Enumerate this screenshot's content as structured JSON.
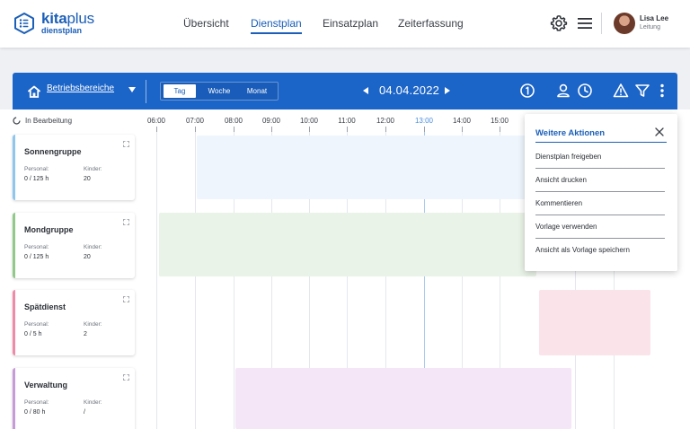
{
  "app": {
    "logo_main_bold": "kita",
    "logo_main_rest": "plus",
    "logo_sub": "dienstplan"
  },
  "nav": {
    "items": [
      {
        "label": "Übersicht",
        "active": false
      },
      {
        "label": "Dienstplan",
        "active": true
      },
      {
        "label": "Einsatzplan",
        "active": false
      },
      {
        "label": "Zeiterfassung",
        "active": false
      }
    ]
  },
  "user": {
    "name": "Lisa Lee",
    "role": "Leitung"
  },
  "toolbar": {
    "area_select": "Betriebsbereiche",
    "views": [
      {
        "label": "Tag",
        "active": true
      },
      {
        "label": "Woche",
        "active": false
      },
      {
        "label": "Monat",
        "active": false
      }
    ],
    "date": "04.04.2022",
    "icons": [
      "info-circle-icon",
      "user-outline-icon",
      "clock-icon",
      "warning-icon",
      "filter-icon",
      "more-vertical-icon"
    ]
  },
  "timeline": {
    "status": "In Bearbeitung",
    "hours": [
      "06:00",
      "07:00",
      "08:00",
      "09:00",
      "10:00",
      "11:00",
      "12:00",
      "13:00",
      "14:00",
      "15:00"
    ],
    "current_hour": "13:00"
  },
  "groups": [
    {
      "name": "Sonnengruppe",
      "personal_label": "Personal:",
      "personal": "0 / 125 h",
      "kinder_label": "Kinder:",
      "kinder": "20",
      "color": "#8fc6ee",
      "bar_color": "#eef5fd"
    },
    {
      "name": "Mondgruppe",
      "personal_label": "Personal:",
      "personal": "0 / 125 h",
      "kinder_label": "Kinder:",
      "kinder": "20",
      "color": "#92c98a",
      "bar_color": "#eaf3e7"
    },
    {
      "name": "Spätdienst",
      "personal_label": "Personal:",
      "personal": "0 / 5 h",
      "kinder_label": "Kinder:",
      "kinder": "2",
      "color": "#ef8aa8",
      "bar_color": "#fbe3ea"
    },
    {
      "name": "Verwaltung",
      "personal_label": "Personal:",
      "personal": "0 / 80 h",
      "kinder_label": "Kinder:",
      "kinder": "/",
      "color": "#c79ad8",
      "bar_color": "#f4e6f6"
    }
  ],
  "menu": {
    "title": "Weitere Aktionen",
    "items": [
      "Dienstplan freigeben",
      "Ansicht drucken",
      "Kommentieren",
      "Vorlage verwenden",
      "Ansicht als Vorlage speichern"
    ]
  }
}
